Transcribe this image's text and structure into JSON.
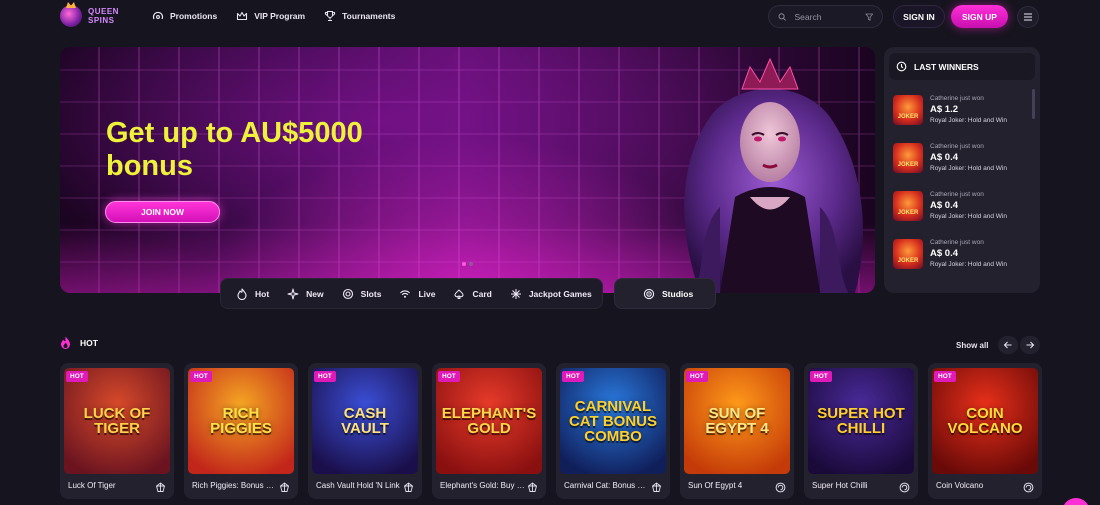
{
  "brand": {
    "line1": "QUEEN",
    "line2": "SPINS"
  },
  "nav": [
    {
      "label": "Promotions",
      "icon": "promotions-icon"
    },
    {
      "label": "VIP Program",
      "icon": "crown-icon"
    },
    {
      "label": "Tournaments",
      "icon": "trophy-icon"
    }
  ],
  "search": {
    "placeholder": "Search",
    "filter_icon": "filter-icon"
  },
  "auth": {
    "signin": "SIGN IN",
    "signup": "SIGN UP"
  },
  "banner": {
    "title": "Get up to AU$5000 bonus",
    "cta": "JOIN NOW",
    "slides": 2,
    "active_slide": 1
  },
  "winners": {
    "title": "LAST WINNERS",
    "items": [
      {
        "who": "Catherine just won",
        "amount": "A$ 1.2",
        "game": "Royal Joker: Hold and Win"
      },
      {
        "who": "Catherine just won",
        "amount": "A$ 0.4",
        "game": "Royal Joker: Hold and Win"
      },
      {
        "who": "Catherine just won",
        "amount": "A$ 0.4",
        "game": "Royal Joker: Hold and Win"
      },
      {
        "who": "Catherine just won",
        "amount": "A$ 0.4",
        "game": "Royal Joker: Hold and Win"
      }
    ]
  },
  "categories": [
    {
      "label": "Hot",
      "icon": "fire-dice-icon"
    },
    {
      "label": "New",
      "icon": "sparkle-icon"
    },
    {
      "label": "Slots",
      "icon": "slot-icon"
    },
    {
      "label": "Live",
      "icon": "live-icon"
    },
    {
      "label": "Card",
      "icon": "cards-icon"
    },
    {
      "label": "Jackpot Games",
      "icon": "jackpot-icon"
    }
  ],
  "studios": {
    "label": "Studios"
  },
  "hot_section": {
    "title": "HOT",
    "show_all": "Show all",
    "badge": "HOT",
    "games": [
      {
        "name": "Luck Of Tiger",
        "art_text": "LUCK OF TIGER",
        "icon": "provider-icon",
        "colors": [
          "#d84a2a",
          "#6b1420"
        ],
        "text_color": "#ffd24a"
      },
      {
        "name": "Rich Piggies: Bonus Combo",
        "art_text": "RICH PIGGIES",
        "icon": "provider-icon",
        "colors": [
          "#f5a623",
          "#c2261a"
        ],
        "text_color": "#ffe04a"
      },
      {
        "name": "Cash Vault Hold 'N Link",
        "art_text": "CASH VAULT",
        "icon": "provider-icon",
        "colors": [
          "#3b4fd8",
          "#1a0f4a"
        ],
        "text_color": "#ffe27a"
      },
      {
        "name": "Elephant's Gold: Buy Bonus Combo",
        "art_text": "ELEPHANT'S GOLD",
        "icon": "provider-icon",
        "colors": [
          "#e83b2a",
          "#8a1010"
        ],
        "text_color": "#ffd84a"
      },
      {
        "name": "Carnival Cat: Bonus Combo",
        "art_text": "CARNIVAL CAT BONUS COMBO",
        "icon": "provider-icon",
        "colors": [
          "#2a7be0",
          "#101e5a"
        ],
        "text_color": "#ffd02a"
      },
      {
        "name": "Sun Of Egypt 4",
        "art_text": "SUN OF EGYPT 4",
        "icon": "studio-swirl-icon",
        "colors": [
          "#ff9a1a",
          "#c43a08"
        ],
        "text_color": "#ffe88a"
      },
      {
        "name": "Super Hot Chilli",
        "art_text": "SUPER HOT CHILLI",
        "icon": "studio-swirl-icon",
        "colors": [
          "#4a2a9a",
          "#1a0a3a"
        ],
        "text_color": "#ffcf2a"
      },
      {
        "name": "Coin Volcano",
        "art_text": "COIN VOLCANO",
        "icon": "studio-swirl-icon",
        "colors": [
          "#e8301a",
          "#6a0a08"
        ],
        "text_color": "#ffdc3a"
      }
    ]
  },
  "colors": {
    "accent": "#ff2fd8",
    "banner_title": "#eef23a",
    "background": "#16141e",
    "panel": "#24212f"
  }
}
